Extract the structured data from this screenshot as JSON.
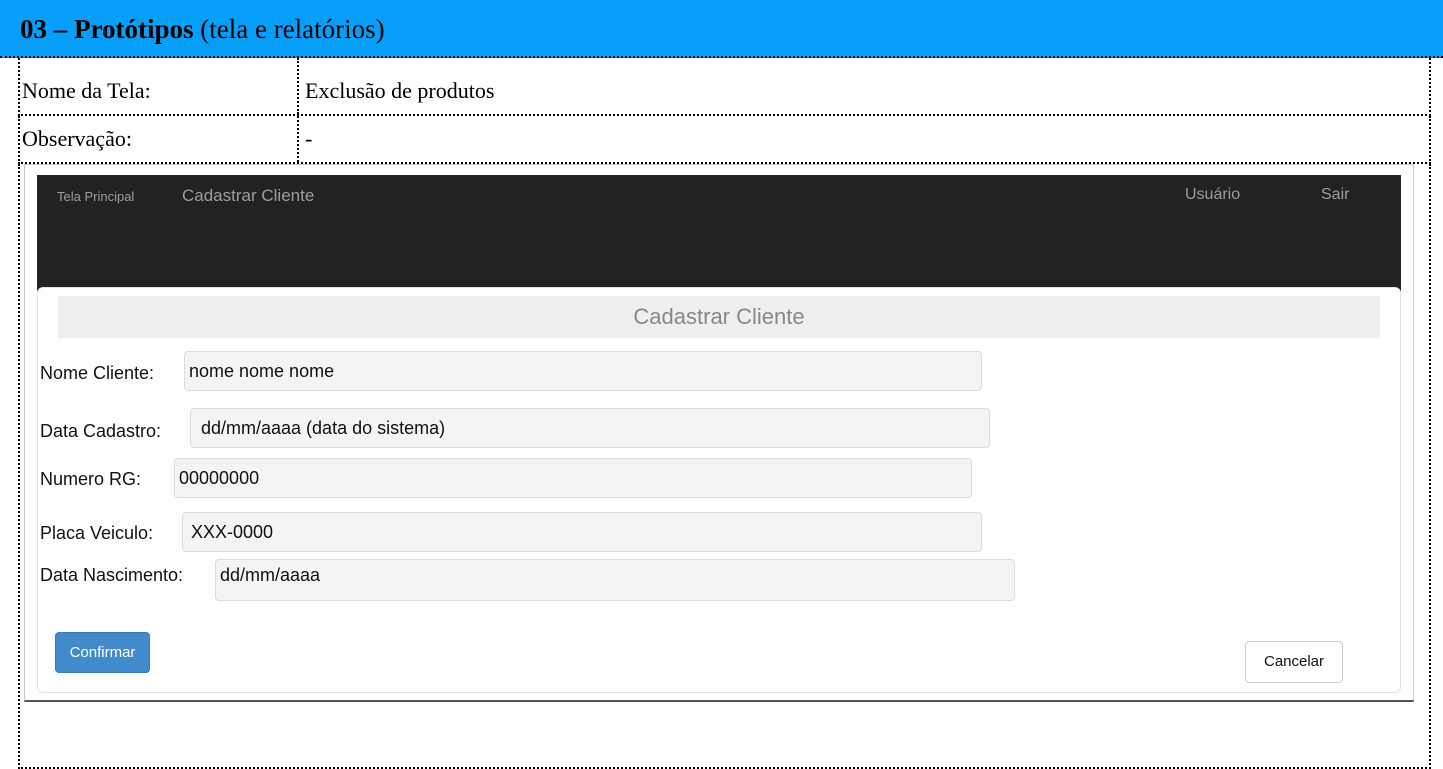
{
  "header": {
    "number": "03 – Protótipos",
    "subtitle": " (tela e relatórios)"
  },
  "info": {
    "screen_name_label": "Nome da Tela:",
    "screen_name_value": "Exclusão de produtos",
    "observation_label": "Observação:",
    "observation_value": "-"
  },
  "prototype": {
    "navbar": {
      "home": "Tela Principal",
      "current": "Cadastrar Cliente",
      "user": "Usuário",
      "logout": "Sair"
    },
    "panel_title": "Cadastrar Cliente",
    "fields": [
      {
        "label": "Nome Cliente:",
        "value": "nome nome nome"
      },
      {
        "label": "Data Cadastro:",
        "value": "dd/mm/aaaa (data do sistema)"
      },
      {
        "label": "Numero RG:",
        "value": "00000000"
      },
      {
        "label": "Placa Veiculo:",
        "value": "XXX-0000"
      },
      {
        "label": "Data Nascimento:",
        "value": "dd/mm/aaaa"
      }
    ],
    "confirm_label": "Confirmar",
    "cancel_label": "Cancelar"
  },
  "colors": {
    "header_bg": "#059ef8",
    "navbar_bg": "#222222",
    "confirm_bg": "#428bca"
  }
}
